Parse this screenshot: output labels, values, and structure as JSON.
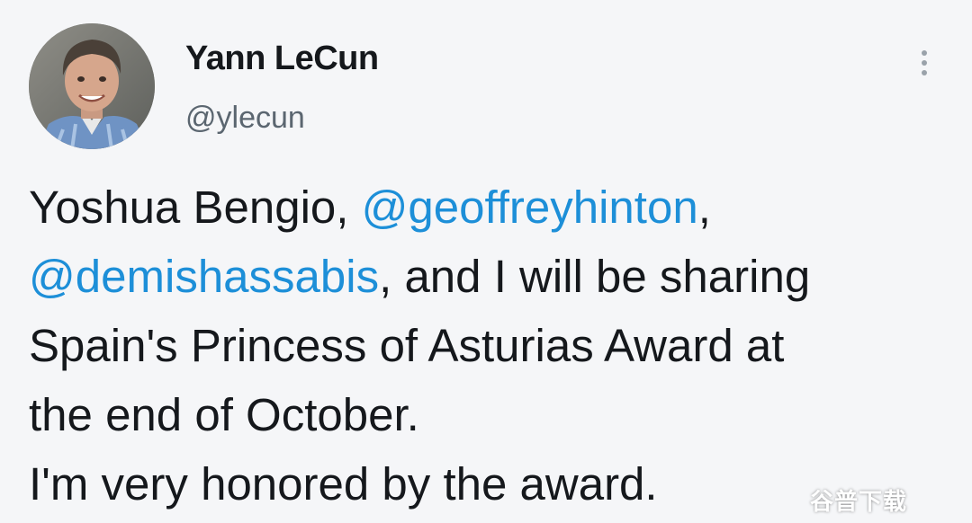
{
  "author": {
    "display_name": "Yann LeCun",
    "handle": "@ylecun"
  },
  "menu": {
    "icon": "more-vertical-icon"
  },
  "tweet": {
    "line1_text": "Yoshua Bengio, ",
    "mention1": "@geoffreyhinton",
    "line1_end": ",",
    "mention2": "@demishassabis",
    "line2_text": ", and I will be sharing",
    "line3_text": "Spain's Princess of Asturias Award at",
    "line4_text": "the end of October.",
    "line5_text": "I'm very honored by the award."
  },
  "watermark": {
    "text": "谷普下载"
  },
  "colors": {
    "background": "#f5f6f8",
    "mention": "#1d8fd8",
    "text": "#15181c",
    "secondary_text": "#5b6670"
  }
}
